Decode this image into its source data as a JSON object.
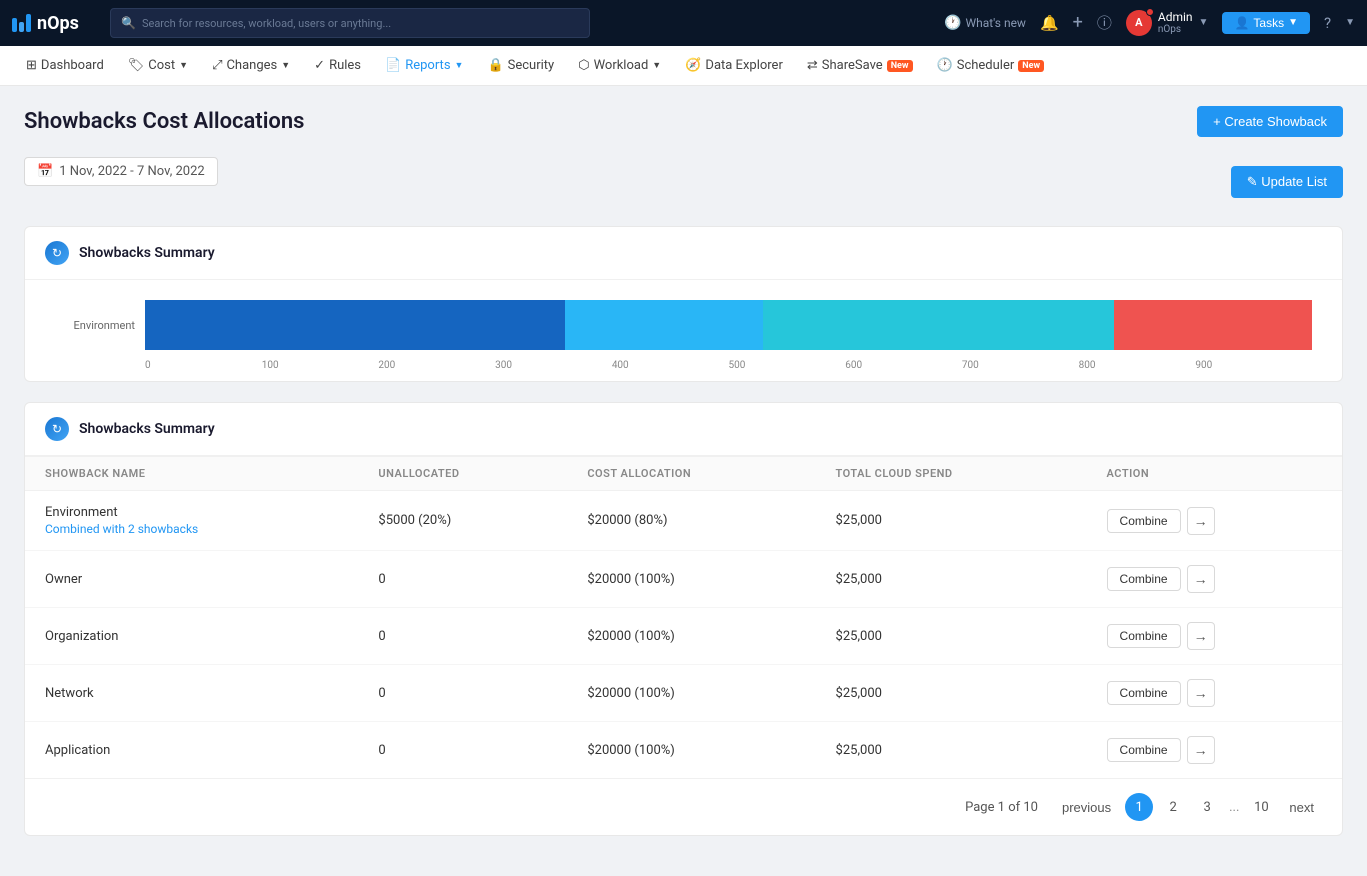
{
  "app": {
    "name": "nOps",
    "logo_text": "nOps"
  },
  "search": {
    "placeholder": "Search for resources, workload, users or anything..."
  },
  "nav_right": {
    "whats_new": "What's new",
    "tasks_label": "Tasks"
  },
  "user": {
    "name": "Admin",
    "sub": "nOps",
    "initials": "A"
  },
  "menubar": {
    "items": [
      {
        "id": "dashboard",
        "label": "Dashboard",
        "icon": "grid"
      },
      {
        "id": "cost",
        "label": "Cost",
        "icon": "tag",
        "has_arrow": true
      },
      {
        "id": "changes",
        "label": "Changes",
        "icon": "git",
        "has_arrow": true
      },
      {
        "id": "rules",
        "label": "Rules",
        "icon": "check"
      },
      {
        "id": "reports",
        "label": "Reports",
        "icon": "file",
        "has_arrow": true,
        "active": true
      },
      {
        "id": "security",
        "label": "Security",
        "icon": "lock"
      },
      {
        "id": "workload",
        "label": "Workload",
        "icon": "layers",
        "has_arrow": true
      },
      {
        "id": "data-explorer",
        "label": "Data Explorer",
        "icon": "compass"
      },
      {
        "id": "sharesave",
        "label": "ShareSave",
        "icon": "share",
        "badge": "New"
      },
      {
        "id": "scheduler",
        "label": "Scheduler",
        "icon": "clock",
        "badge": "New"
      }
    ]
  },
  "page": {
    "title": "Showbacks Cost Allocations",
    "create_btn": "+ Create Showback",
    "update_btn": "✎ Update List",
    "date_range": "1 Nov, 2022 - 7 Nov, 2022"
  },
  "chart": {
    "title": "Showbacks Summary",
    "y_label": "Environment",
    "segments": [
      {
        "color": "#1565c0",
        "width_pct": 36
      },
      {
        "color": "#29b6f6",
        "width_pct": 17
      },
      {
        "color": "#26c6da",
        "width_pct": 30
      },
      {
        "color": "#ef5350",
        "width_pct": 17
      }
    ],
    "x_ticks": [
      "0",
      "100",
      "200",
      "300",
      "400",
      "500",
      "600",
      "700",
      "800",
      "900"
    ]
  },
  "table": {
    "title": "Showbacks Summary",
    "columns": [
      "SHOWBACK NAME",
      "UNALLOCATED",
      "COST ALLOCATION",
      "TOTAL CLOUD SPEND",
      "ACTION"
    ],
    "rows": [
      {
        "name": "Environment",
        "sub": "Combined with 2 showbacks",
        "unallocated": "$5000 (20%)",
        "cost_allocation": "$20000 (80%)",
        "total_spend": "$25,000",
        "has_link": true
      },
      {
        "name": "Owner",
        "sub": "",
        "unallocated": "0",
        "cost_allocation": "$20000 (100%)",
        "total_spend": "$25,000",
        "has_link": false
      },
      {
        "name": "Organization",
        "sub": "",
        "unallocated": "0",
        "cost_allocation": "$20000 (100%)",
        "total_spend": "$25,000",
        "has_link": false
      },
      {
        "name": "Network",
        "sub": "",
        "unallocated": "0",
        "cost_allocation": "$20000 (100%)",
        "total_spend": "$25,000",
        "has_link": false
      },
      {
        "name": "Application",
        "sub": "",
        "unallocated": "0",
        "cost_allocation": "$20000 (100%)",
        "total_spend": "$25,000",
        "has_link": false
      }
    ],
    "combine_label": "Combine"
  },
  "pagination": {
    "page_info": "Page 1 of 10",
    "previous": "previous",
    "next": "next",
    "pages": [
      "1",
      "2",
      "3",
      "...",
      "10"
    ],
    "active_page": "1"
  }
}
